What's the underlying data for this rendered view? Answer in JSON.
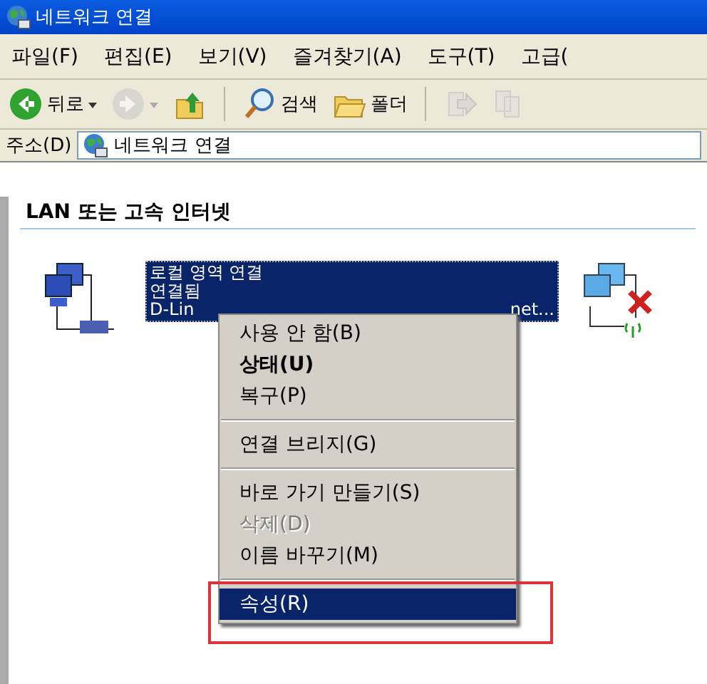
{
  "window": {
    "title": "네트워크 연결"
  },
  "menu_bar": [
    "파일(F)",
    "편집(E)",
    "보기(V)",
    "즐겨찾기(A)",
    "도구(T)",
    "고급("
  ],
  "toolbar": [
    {
      "kind": "back",
      "label": "뒤로",
      "disabled": false
    },
    {
      "kind": "forward",
      "disabled": true
    },
    {
      "kind": "up",
      "disabled": false
    },
    {
      "kind": "search",
      "label": "검색",
      "disabled": false
    },
    {
      "kind": "folders",
      "label": "폴더",
      "disabled": false
    },
    {
      "kind": "move",
      "disabled": true
    },
    {
      "kind": "copy",
      "disabled": true
    }
  ],
  "address_bar": {
    "label": "주소(D)",
    "value": "네트워크 연결"
  },
  "group": {
    "title": "LAN 또는 고속 인터넷"
  },
  "connections": [
    {
      "kind": "lan",
      "selected": true,
      "lines": [
        "로컬 영역 연결",
        "연결됨",
        "D-Lin"
      ],
      "tail": "net..."
    },
    {
      "kind": "wireless_disconnected",
      "selected": false
    }
  ],
  "context_menu": [
    {
      "kind": "item",
      "label": "사용 안 함(B)",
      "default": false,
      "disabled": false,
      "selected": false
    },
    {
      "kind": "item",
      "label": "상태(U)",
      "default": true,
      "disabled": false,
      "selected": false
    },
    {
      "kind": "item",
      "label": "복구(P)",
      "default": false,
      "disabled": false,
      "selected": false
    },
    {
      "kind": "separator"
    },
    {
      "kind": "item",
      "label": "연결 브리지(G)",
      "default": false,
      "disabled": false,
      "selected": false
    },
    {
      "kind": "separator"
    },
    {
      "kind": "item",
      "label": "바로 가기 만들기(S)",
      "default": false,
      "disabled": false,
      "selected": false
    },
    {
      "kind": "item",
      "label": "삭제(D)",
      "default": false,
      "disabled": true,
      "selected": false
    },
    {
      "kind": "item",
      "label": "이름 바꾸기(M)",
      "default": false,
      "disabled": false,
      "selected": false
    },
    {
      "kind": "separator"
    },
    {
      "kind": "item",
      "label": "속성(R)",
      "default": false,
      "disabled": false,
      "selected": true
    }
  ]
}
